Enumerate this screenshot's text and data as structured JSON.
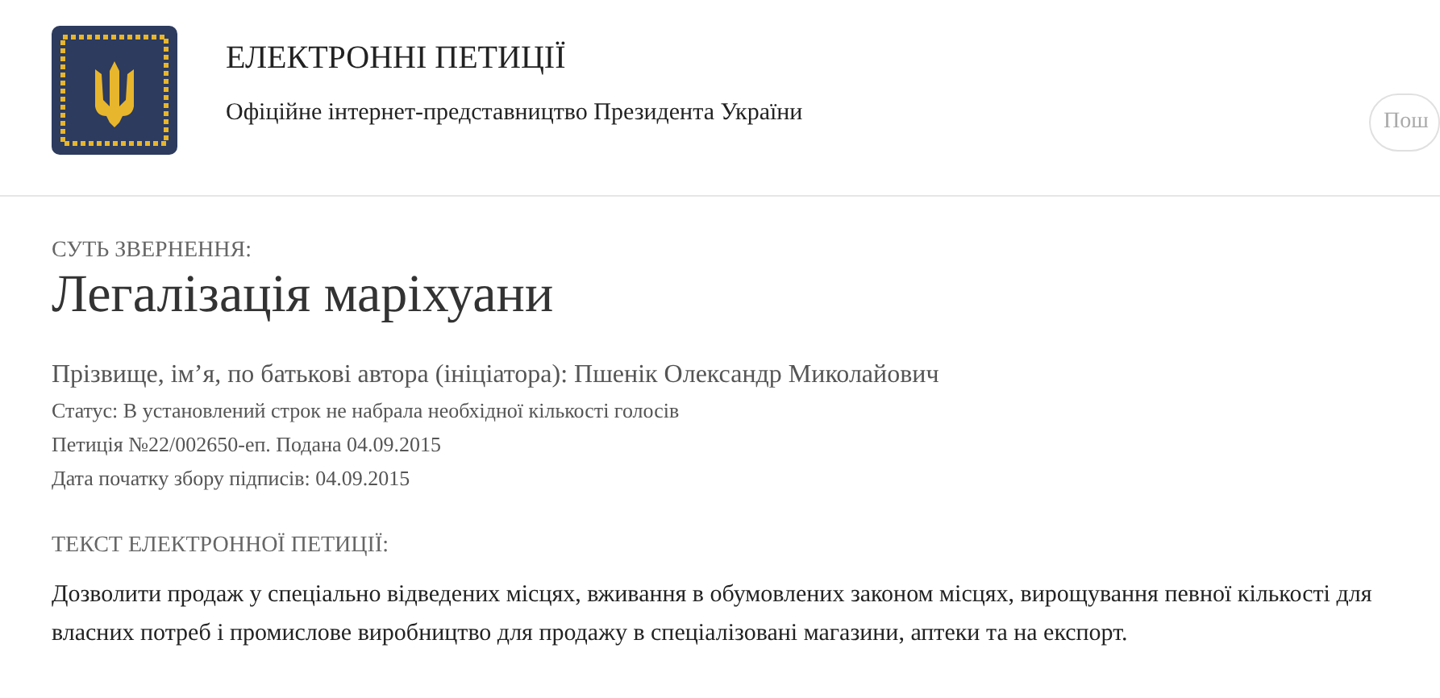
{
  "header": {
    "title": "ЕЛЕКТРОННІ ПЕТИЦІЇ",
    "subtitle": "Офіційне інтернет-представництво Президента України",
    "search": {
      "placeholder": "Пош"
    }
  },
  "petition": {
    "subject_label": "СУТЬ ЗВЕРНЕННЯ:",
    "title": "Легалізація маріхуани",
    "author": "Прізвище, ім’я, по батькові автора (ініціатора): Пшенік Олександр Миколайович",
    "meta": [
      "Статус: В установлений строк не набрала необхідної кількості голосів",
      "Петиція №22/002650-еп. Подана 04.09.2015",
      "Дата початку збору підписів: 04.09.2015"
    ],
    "text_label": "ТЕКСТ ЕЛЕКТРОННОЇ ПЕТИЦІЇ:",
    "text": "Дозволити продаж у спеціально відведених місцях, вживання в обумовлених законом місцях, вирощування певної кількості для власних потреб і промислове виробництво для продажу в спеціалізовані магазини, аптеки та на експорт."
  }
}
